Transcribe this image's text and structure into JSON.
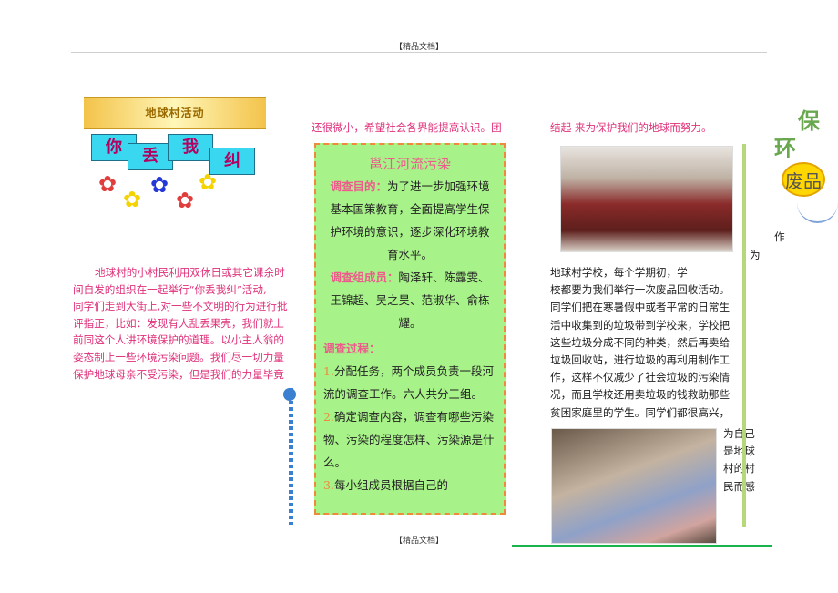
{
  "header": {
    "text": "【精品文档】"
  },
  "footer": {
    "text": "【精品文档】"
  },
  "banner": {
    "title": "地球村活动"
  },
  "slogan": {
    "chars": [
      "你",
      "丢",
      "我",
      "纠"
    ]
  },
  "left_paragraph": {
    "lines": [
      "地球村的小村民利用双休日或其它课余时",
      "间自发的组织在一起举行“你丢我纠”活动,",
      "同学们走到大街上,对一些不文明的行为进行批",
      "评指正，比如：发现有人乱丢果壳，我们就上",
      "前同这个人讲环境保护的道理。以小主人翁的",
      "姿态制止一些环境污染问题。我们尽一切力量",
      "保护地球母亲不受污染，但是我们的力量毕竟"
    ]
  },
  "middle_top": {
    "text": "还很微小，希望社会各界能提高认识。团"
  },
  "survey_box": {
    "title": "邕江河流污染",
    "purpose_label": "调查目的：",
    "purpose_text": "为了进一步加强环境基本国策教育，全面提高学生保护环境的意识，逐步深化环境教育水平。",
    "members_label": "调查组成员：",
    "members_text": "陶泽轩、陈露雯、王锦超、吴之昊、范淑华、俞栋耀。",
    "process_label": "调查过程：",
    "step1_num": "1.",
    "step1_text": "分配任务，两个成员负责一段河流的调查工作。六人共分三组。",
    "step2_num": "2.",
    "step2_text": "确定调查内容，调查有哪些污染物、污染的程度怎样、污染源是什么。",
    "step3_num": "3.",
    "step3_text": "每小组成员根据自己的"
  },
  "right_column": {
    "top_text": "结起 来为保护我们的地球而努力。",
    "side_wei": "为",
    "paragraph_lines": [
      "地球村学校，每个学期初，学",
      "校都要为我们举行一次废品回收活动。",
      "同学们把在寒暑假中或者平常的日常生",
      "活中收集到的垃圾带到学校来，学校把",
      "这些垃圾分成不同的种类，然后再卖给",
      "垃圾回收站，进行垃圾的再利用制作工",
      "作，这样不仅减少了社会垃圾的污染情",
      "况，而且学校还用卖垃圾的钱救助那些",
      "贫困家庭里的学生。同学们都很高兴，"
    ],
    "tail_lines": [
      "为自己",
      "是地球",
      "村的村",
      "民而感"
    ]
  },
  "right_deco": {
    "bao": "保",
    "huan": "环",
    "feipin": "废品",
    "zuo": "作"
  }
}
